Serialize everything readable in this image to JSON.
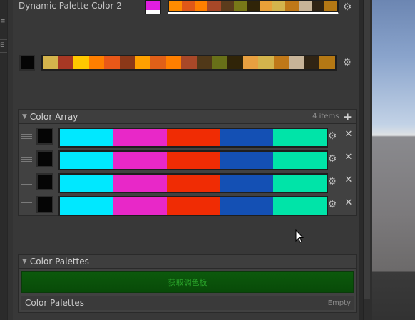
{
  "fields": {
    "dynamic_palette_2": {
      "label": "Dynamic Palette Color 2",
      "swatch_top": "#e01ee0",
      "swatch_bottom": "#ffffff",
      "colors": [
        "#ff8c00",
        "#e05818",
        "#ff7f00",
        "#a84828",
        "#5c3c1c",
        "#787818",
        "#302408",
        "#e8a038",
        "#d4b44c",
        "#c07818",
        "#c8b498",
        "#302414",
        "#b47814"
      ]
    },
    "palette_field": {
      "swatch": "#050505",
      "colors": [
        "#d4b44c",
        "#a83824",
        "#ffc800",
        "#ff7f00",
        "#e85818",
        "#8c3818",
        "#ffa000",
        "#e06018",
        "#ff7f00",
        "#a84828",
        "#503818",
        "#687018",
        "#302408",
        "#e8a040",
        "#d4b44c",
        "#c07818",
        "#c8b498",
        "#302414",
        "#b47814"
      ]
    }
  },
  "color_array": {
    "title": "Color Array",
    "count_label": "4 items",
    "add_icon": "plus-icon",
    "rows": [
      {
        "swatch": "#050505",
        "colors": [
          "#00e8ff",
          "#e828c8",
          "#f02c04",
          "#1450b4",
          "#00e4a8"
        ]
      },
      {
        "swatch": "#050505",
        "colors": [
          "#00e8ff",
          "#e828c8",
          "#f02c04",
          "#1450b4",
          "#00e4a8"
        ]
      },
      {
        "swatch": "#050505",
        "colors": [
          "#00e8ff",
          "#e828c8",
          "#f02c04",
          "#1450b4",
          "#00e4a8"
        ]
      },
      {
        "swatch": "#050505",
        "colors": [
          "#00e8ff",
          "#e828c8",
          "#f02c04",
          "#1450b4",
          "#00e4a8"
        ]
      }
    ]
  },
  "color_palettes": {
    "title": "Color Palettes",
    "get_button_label": "获取调色板",
    "field_label": "Color Palettes",
    "field_value": "Empty"
  },
  "left_glyphs": [
    "≡",
    "E"
  ],
  "icons": {
    "gear": "gear-icon",
    "remove": "remove-icon",
    "handle": "drag-handle-icon",
    "foldout": "foldout-triangle-icon"
  }
}
